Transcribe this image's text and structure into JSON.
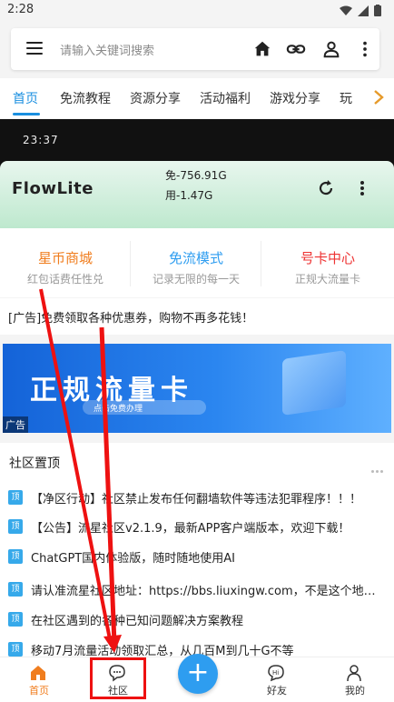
{
  "status_bar": {
    "time": "2:28"
  },
  "search": {
    "placeholder": "请输入关键词搜索"
  },
  "tabs": [
    {
      "label": "首页",
      "active": true
    },
    {
      "label": "免流教程"
    },
    {
      "label": "资源分享"
    },
    {
      "label": "活动福利"
    },
    {
      "label": "游戏分享"
    },
    {
      "label": "玩"
    }
  ],
  "banner": {
    "phone_time": "23:37",
    "app_name": "FlowLite",
    "stat_free": "免-756.91G",
    "stat_used": "用-1.47G"
  },
  "cards": [
    {
      "title": "星币商城",
      "subtitle": "红包话费任性兑",
      "color": "#f07d1e"
    },
    {
      "title": "免流模式",
      "subtitle": "记录无限的每一天",
      "color": "#2e9df0"
    },
    {
      "title": "号卡中心",
      "subtitle": "正规大流量卡",
      "color": "#e33"
    }
  ],
  "ad_text": "[广告]免费领取各种优惠券，购物不再多花钱！",
  "ad_image": {
    "headline": "正规流量卡",
    "button_text": "点击免费办理",
    "tag": "广告"
  },
  "community": {
    "header": "社区置顶",
    "badge_label": "顶",
    "posts": [
      "【净区行动】社区禁止发布任何翻墙软件等违法犯罪程序！！！",
      "【公告】流星社区v2.1.9，最新APP客户端版本，欢迎下载！",
      "ChatGPT国内体验版，随时随地使用AI",
      "请认准流星社区地址：https://bbs.liuxingw.com，不是这个地址的都是假的",
      "在社区遇到的各种已知问题解决方案教程",
      "移动7月流量活动领取汇总，从几百M到几十G不等"
    ]
  },
  "bottom_nav": [
    {
      "label": "首页",
      "icon": "home-icon",
      "active": true
    },
    {
      "label": "社区",
      "icon": "chat-icon"
    },
    {
      "label": "好友",
      "icon": "friends-chat-icon"
    },
    {
      "label": "我的",
      "icon": "profile-icon"
    }
  ],
  "colors": {
    "accent": "#1a8fe0",
    "active_nav": "#f07d1e",
    "fab": "#2e9df0",
    "annotation": "#e11"
  }
}
